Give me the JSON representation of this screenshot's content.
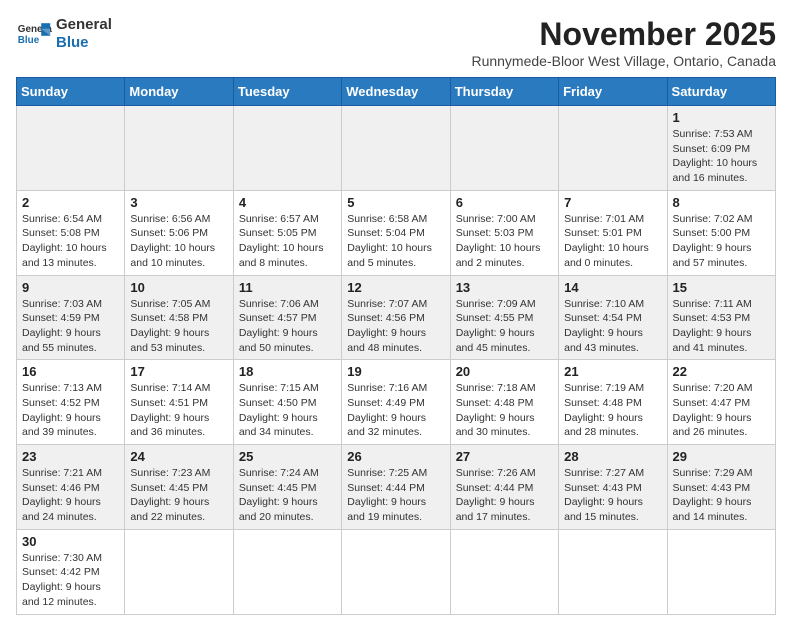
{
  "header": {
    "logo_general": "General",
    "logo_blue": "Blue",
    "month_title": "November 2025",
    "subtitle": "Runnymede-Bloor West Village, Ontario, Canada"
  },
  "weekdays": [
    "Sunday",
    "Monday",
    "Tuesday",
    "Wednesday",
    "Thursday",
    "Friday",
    "Saturday"
  ],
  "weeks": [
    [
      {
        "day": "",
        "info": ""
      },
      {
        "day": "",
        "info": ""
      },
      {
        "day": "",
        "info": ""
      },
      {
        "day": "",
        "info": ""
      },
      {
        "day": "",
        "info": ""
      },
      {
        "day": "",
        "info": ""
      },
      {
        "day": "1",
        "info": "Sunrise: 7:53 AM\nSunset: 6:09 PM\nDaylight: 10 hours and 16 minutes."
      }
    ],
    [
      {
        "day": "2",
        "info": "Sunrise: 6:54 AM\nSunset: 5:08 PM\nDaylight: 10 hours and 13 minutes."
      },
      {
        "day": "3",
        "info": "Sunrise: 6:56 AM\nSunset: 5:06 PM\nDaylight: 10 hours and 10 minutes."
      },
      {
        "day": "4",
        "info": "Sunrise: 6:57 AM\nSunset: 5:05 PM\nDaylight: 10 hours and 8 minutes."
      },
      {
        "day": "5",
        "info": "Sunrise: 6:58 AM\nSunset: 5:04 PM\nDaylight: 10 hours and 5 minutes."
      },
      {
        "day": "6",
        "info": "Sunrise: 7:00 AM\nSunset: 5:03 PM\nDaylight: 10 hours and 2 minutes."
      },
      {
        "day": "7",
        "info": "Sunrise: 7:01 AM\nSunset: 5:01 PM\nDaylight: 10 hours and 0 minutes."
      },
      {
        "day": "8",
        "info": "Sunrise: 7:02 AM\nSunset: 5:00 PM\nDaylight: 9 hours and 57 minutes."
      }
    ],
    [
      {
        "day": "9",
        "info": "Sunrise: 7:03 AM\nSunset: 4:59 PM\nDaylight: 9 hours and 55 minutes."
      },
      {
        "day": "10",
        "info": "Sunrise: 7:05 AM\nSunset: 4:58 PM\nDaylight: 9 hours and 53 minutes."
      },
      {
        "day": "11",
        "info": "Sunrise: 7:06 AM\nSunset: 4:57 PM\nDaylight: 9 hours and 50 minutes."
      },
      {
        "day": "12",
        "info": "Sunrise: 7:07 AM\nSunset: 4:56 PM\nDaylight: 9 hours and 48 minutes."
      },
      {
        "day": "13",
        "info": "Sunrise: 7:09 AM\nSunset: 4:55 PM\nDaylight: 9 hours and 45 minutes."
      },
      {
        "day": "14",
        "info": "Sunrise: 7:10 AM\nSunset: 4:54 PM\nDaylight: 9 hours and 43 minutes."
      },
      {
        "day": "15",
        "info": "Sunrise: 7:11 AM\nSunset: 4:53 PM\nDaylight: 9 hours and 41 minutes."
      }
    ],
    [
      {
        "day": "16",
        "info": "Sunrise: 7:13 AM\nSunset: 4:52 PM\nDaylight: 9 hours and 39 minutes."
      },
      {
        "day": "17",
        "info": "Sunrise: 7:14 AM\nSunset: 4:51 PM\nDaylight: 9 hours and 36 minutes."
      },
      {
        "day": "18",
        "info": "Sunrise: 7:15 AM\nSunset: 4:50 PM\nDaylight: 9 hours and 34 minutes."
      },
      {
        "day": "19",
        "info": "Sunrise: 7:16 AM\nSunset: 4:49 PM\nDaylight: 9 hours and 32 minutes."
      },
      {
        "day": "20",
        "info": "Sunrise: 7:18 AM\nSunset: 4:48 PM\nDaylight: 9 hours and 30 minutes."
      },
      {
        "day": "21",
        "info": "Sunrise: 7:19 AM\nSunset: 4:48 PM\nDaylight: 9 hours and 28 minutes."
      },
      {
        "day": "22",
        "info": "Sunrise: 7:20 AM\nSunset: 4:47 PM\nDaylight: 9 hours and 26 minutes."
      }
    ],
    [
      {
        "day": "23",
        "info": "Sunrise: 7:21 AM\nSunset: 4:46 PM\nDaylight: 9 hours and 24 minutes."
      },
      {
        "day": "24",
        "info": "Sunrise: 7:23 AM\nSunset: 4:45 PM\nDaylight: 9 hours and 22 minutes."
      },
      {
        "day": "25",
        "info": "Sunrise: 7:24 AM\nSunset: 4:45 PM\nDaylight: 9 hours and 20 minutes."
      },
      {
        "day": "26",
        "info": "Sunrise: 7:25 AM\nSunset: 4:44 PM\nDaylight: 9 hours and 19 minutes."
      },
      {
        "day": "27",
        "info": "Sunrise: 7:26 AM\nSunset: 4:44 PM\nDaylight: 9 hours and 17 minutes."
      },
      {
        "day": "28",
        "info": "Sunrise: 7:27 AM\nSunset: 4:43 PM\nDaylight: 9 hours and 15 minutes."
      },
      {
        "day": "29",
        "info": "Sunrise: 7:29 AM\nSunset: 4:43 PM\nDaylight: 9 hours and 14 minutes."
      }
    ],
    [
      {
        "day": "30",
        "info": "Sunrise: 7:30 AM\nSunset: 4:42 PM\nDaylight: 9 hours and 12 minutes."
      },
      {
        "day": "",
        "info": ""
      },
      {
        "day": "",
        "info": ""
      },
      {
        "day": "",
        "info": ""
      },
      {
        "day": "",
        "info": ""
      },
      {
        "day": "",
        "info": ""
      },
      {
        "day": "",
        "info": ""
      }
    ]
  ]
}
